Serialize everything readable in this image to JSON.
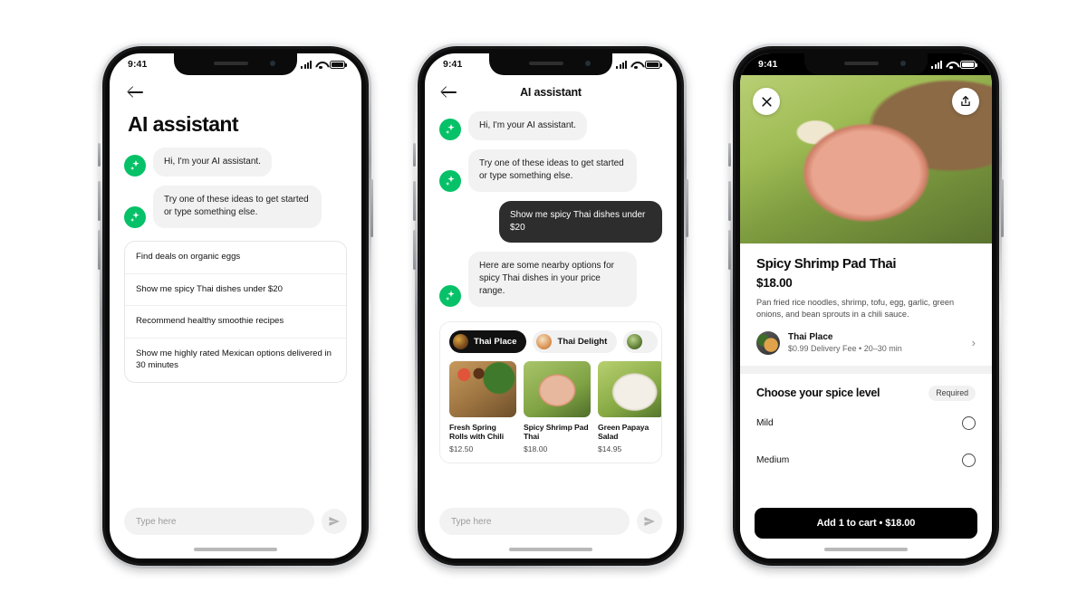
{
  "status_bar": {
    "time": "9:41",
    "signal_icon": "cellular-bars-icon",
    "wifi_icon": "wifi-icon",
    "battery_icon": "battery-icon"
  },
  "phone1": {
    "back_icon": "back-arrow-icon",
    "title": "AI assistant",
    "assistant_icon": "sparkle-icon",
    "messages": [
      {
        "sender": "assistant",
        "text": "Hi, I'm your AI assistant."
      },
      {
        "sender": "assistant",
        "text": "Try one of these ideas to get started or type something else."
      }
    ],
    "suggestions": [
      "Find deals on organic eggs",
      "Show me spicy Thai dishes under $20",
      "Recommend healthy smoothie recipes",
      "Show me highly rated Mexican options delivered in 30 minutes"
    ],
    "composer": {
      "placeholder": "Type here",
      "send_icon": "send-icon"
    }
  },
  "phone2": {
    "back_icon": "back-arrow-icon",
    "title": "AI assistant",
    "assistant_icon": "sparkle-icon",
    "messages": [
      {
        "sender": "assistant",
        "text": "Hi, I'm your AI assistant."
      },
      {
        "sender": "assistant",
        "text": "Try one of these ideas to get started or type something else."
      },
      {
        "sender": "user",
        "text": "Show me spicy Thai dishes under $20"
      },
      {
        "sender": "assistant",
        "text": "Here are some nearby options for spicy Thai dishes in your price range."
      }
    ],
    "restaurant_chips": [
      {
        "label": "Thai Place",
        "selected": true
      },
      {
        "label": "Thai Delight",
        "selected": false
      },
      {
        "label": "",
        "selected": false
      }
    ],
    "dishes": [
      {
        "name": "Fresh Spring Rolls with Chili",
        "price": "$12.50"
      },
      {
        "name": "Spicy Shrimp Pad Thai",
        "price": "$18.00"
      },
      {
        "name": "Green Papaya Salad",
        "price": "$14.95"
      }
    ],
    "composer": {
      "placeholder": "Type here",
      "send_icon": "send-icon"
    }
  },
  "phone3": {
    "close_icon": "close-icon",
    "share_icon": "share-icon",
    "item_name": "Spicy Shrimp Pad Thai",
    "item_price": "$18.00",
    "item_description": "Pan fried rice noodles, shrimp, tofu, egg, garlic, green onions, and bean sprouts in a chili sauce.",
    "restaurant": {
      "name": "Thai Place",
      "meta": "$0.99 Delivery Fee • 20–30 min",
      "chevron_icon": "chevron-right-icon"
    },
    "option_group": {
      "title": "Choose your spice level",
      "badge": "Required",
      "options": [
        {
          "label": "Mild",
          "selected": false
        },
        {
          "label": "Medium",
          "selected": false
        }
      ]
    },
    "cta_label": "Add 1 to cart • $18.00"
  },
  "colors": {
    "brand_green": "#06c167",
    "user_bubble": "#2d2d2d",
    "assistant_bubble": "#f2f2f2",
    "cta_black": "#000000"
  }
}
